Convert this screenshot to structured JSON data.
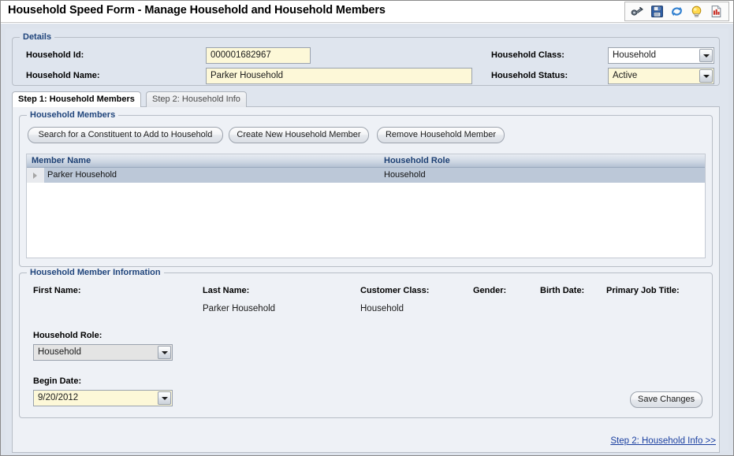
{
  "window": {
    "title": "Household Speed Form - Manage Household and Household Members"
  },
  "toolbar": {
    "icons": [
      {
        "name": "binoculars-icon",
        "label": "Search"
      },
      {
        "name": "save-icon",
        "label": "Save"
      },
      {
        "name": "refresh-icon",
        "label": "Refresh"
      },
      {
        "name": "lightbulb-icon",
        "label": "Hint"
      },
      {
        "name": "report-icon",
        "label": "Report"
      }
    ]
  },
  "details": {
    "legend": "Details",
    "household_id_label": "Household Id:",
    "household_id_value": "000001682967",
    "household_name_label": "Household Name:",
    "household_name_value": "Parker Household",
    "household_class_label": "Household Class:",
    "household_class_value": "Household",
    "household_status_label": "Household Status:",
    "household_status_value": "Active"
  },
  "tabs": [
    {
      "label": "Step 1: Household Members",
      "active": true
    },
    {
      "label": "Step 2: Household Info",
      "active": false
    }
  ],
  "members": {
    "legend": "Household Members",
    "buttons": {
      "search": "Search for a Constituent to Add to Household",
      "create": "Create New Household Member",
      "remove": "Remove Household Member"
    },
    "grid": {
      "columns": [
        "Member Name",
        "Household Role"
      ],
      "rows": [
        {
          "member_name": "Parker Household",
          "household_role": "Household"
        }
      ]
    }
  },
  "member_info": {
    "legend": "Household Member Information",
    "labels": {
      "first_name": "First Name:",
      "last_name": "Last Name:",
      "customer_class": "Customer Class:",
      "gender": "Gender:",
      "birth_date": "Birth Date:",
      "primary_job_title": "Primary Job Title:"
    },
    "values": {
      "first_name": "",
      "last_name": "Parker Household",
      "customer_class": "Household",
      "gender": "",
      "birth_date": "",
      "primary_job_title": ""
    },
    "household_role_label": "Household Role:",
    "household_role_value": "Household",
    "begin_date_label": "Begin Date:",
    "begin_date_value": "9/20/2012",
    "save_changes_label": "Save Changes"
  },
  "footer": {
    "next_step_link": "Step 2: Household Info >>"
  },
  "colors": {
    "accent_blue": "#20457c",
    "link_blue": "#1a3fa0",
    "field_yellow": "#fdf8d8",
    "panel_bg": "#eef1f6",
    "window_bg": "#dfe5ee",
    "grid_header_text": "#1c3f73",
    "row_selected": "#bcc8d8"
  }
}
